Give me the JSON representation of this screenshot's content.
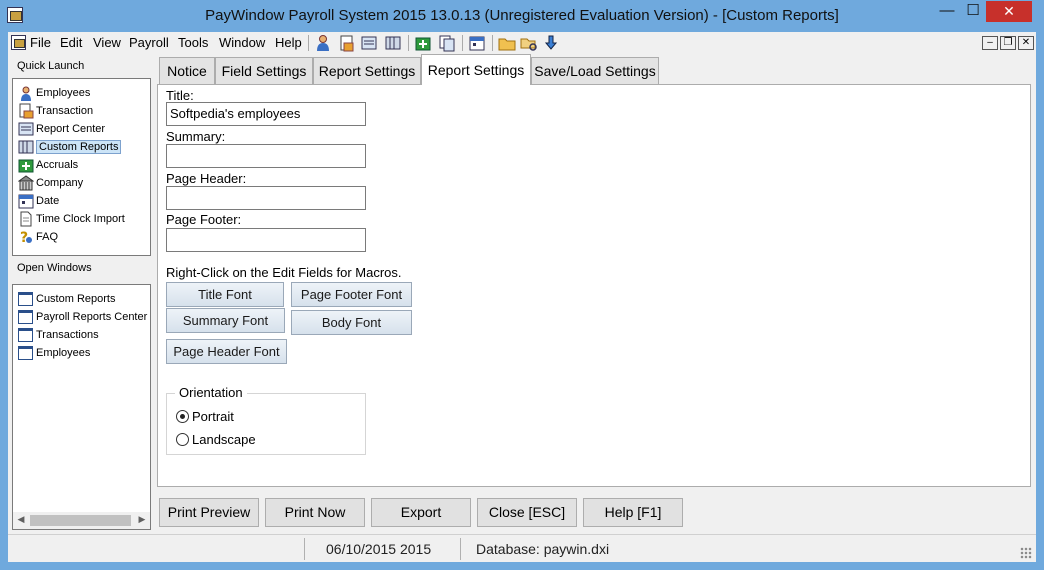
{
  "window": {
    "title": "PayWindow Payroll System 2015  13.0.13 (Unregistered Evaluation Version) - [Custom Reports]",
    "minimize": "—",
    "maximize": "☐",
    "close": "✕"
  },
  "menu": [
    {
      "label": "File",
      "key": "F"
    },
    {
      "label": "Edit",
      "key": "E"
    },
    {
      "label": "View",
      "key": "V"
    },
    {
      "label": "Payroll",
      "key": "P"
    },
    {
      "label": "Tools",
      "key": "T"
    },
    {
      "label": "Window",
      "key": "W"
    },
    {
      "label": "Help",
      "key": "H"
    }
  ],
  "mdi_controls": {
    "minimize": "–",
    "restore": "❐",
    "close": "✕"
  },
  "quick_launch": {
    "label": "Quick Launch",
    "items": [
      "Employees",
      "Transaction",
      "Report Center",
      "Custom Reports",
      "Accruals",
      "Company",
      "Date",
      "Time Clock Import",
      "FAQ"
    ],
    "selected": "Custom Reports"
  },
  "open_windows": {
    "label": "Open Windows",
    "items": [
      "Custom Reports",
      "Payroll Reports Center",
      "Transactions",
      "Employees"
    ]
  },
  "tabs": [
    "Notice",
    "Field Settings",
    "Report Settings",
    "Report Settings",
    "Save/Load Settings"
  ],
  "active_tab_index": 3,
  "form": {
    "title_label": "Title:",
    "title_value": "Softpedia's employees",
    "summary_label": "Summary:",
    "summary_value": "",
    "page_header_label": "Page Header:",
    "page_header_value": "",
    "page_footer_label": "Page Footer:",
    "page_footer_value": "",
    "macro_note": "Right-Click on the Edit Fields for Macros.",
    "buttons": {
      "title_font": "Title Font",
      "page_footer_font": "Page Footer Font",
      "summary_font": "Summary Font",
      "body_font": "Body Font",
      "page_header_font": "Page Header Font"
    },
    "orientation": {
      "label": "Orientation",
      "options": [
        "Portrait",
        "Landscape"
      ],
      "selected": "Portrait"
    }
  },
  "bottom_buttons": [
    "Print Preview",
    "Print Now",
    "Export",
    "Close [ESC]",
    "Help [F1]"
  ],
  "status": {
    "date": "06/10/2015 2015",
    "database": "Database: paywin.dxi"
  },
  "colors": {
    "title_bar": "#6fa9dd",
    "close_button": "#c7302b",
    "selection": "#cce4f7"
  }
}
